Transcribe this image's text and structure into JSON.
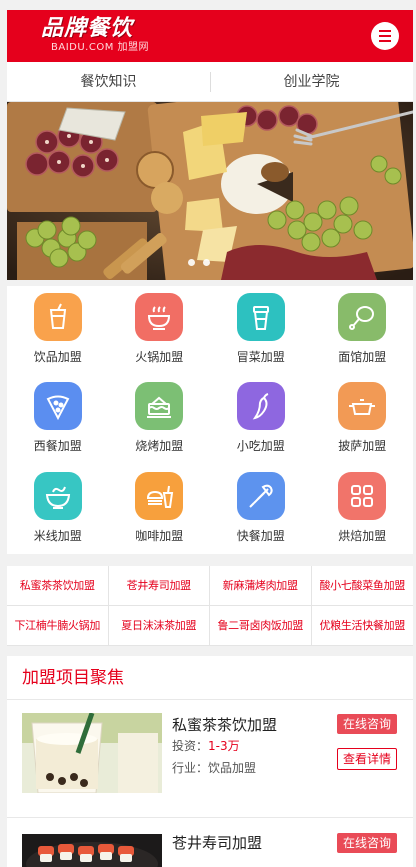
{
  "header": {
    "logo_main": "品牌餐饮",
    "logo_sub": "BAIDU.COM 加盟网",
    "menu_icon": "hamburger-menu-icon"
  },
  "nav": {
    "items": [
      {
        "label": "餐饮知识"
      },
      {
        "label": "创业学院"
      }
    ]
  },
  "banner": {
    "image": "food-platter-photo",
    "slides": 2
  },
  "categories": [
    {
      "label": "饮品加盟",
      "icon": "drink-cup-icon",
      "color": "#f9a24c"
    },
    {
      "label": "火锅加盟",
      "icon": "hotpot-icon",
      "color": "#f16e64"
    },
    {
      "label": "冒菜加盟",
      "icon": "takeaway-cup-icon",
      "color": "#2dc1c0"
    },
    {
      "label": "面馆加盟",
      "icon": "chicken-leg-icon",
      "color": "#88bb6a"
    },
    {
      "label": "西餐加盟",
      "icon": "pizza-icon",
      "color": "#5b8ef0"
    },
    {
      "label": "烧烤加盟",
      "icon": "cake-icon",
      "color": "#7cbf74"
    },
    {
      "label": "小吃加盟",
      "icon": "chili-icon",
      "color": "#8e67e0"
    },
    {
      "label": "披萨加盟",
      "icon": "pot-icon",
      "color": "#f29a55"
    },
    {
      "label": "米线加盟",
      "icon": "noodle-bowl-icon",
      "color": "#37c6c3"
    },
    {
      "label": "咖啡加盟",
      "icon": "burger-drink-icon",
      "color": "#f7a03d"
    },
    {
      "label": "快餐加盟",
      "icon": "ice-cream-icon",
      "color": "#5d93ee"
    },
    {
      "label": "烘焙加盟",
      "icon": "grid-squares-icon",
      "color": "#f1746a"
    }
  ],
  "hot_links": [
    "私蜜茶茶饮加盟",
    "苍井寿司加盟",
    "新麻蒲烤肉加盟",
    "酸小七酸菜鱼加盟",
    "下江楠牛腩火锅加",
    "夏日沫沫茶加盟",
    "鲁二哥卤肉饭加盟",
    "优粮生活快餐加盟"
  ],
  "section": {
    "title": "加盟项目聚焦",
    "items": [
      {
        "name": "私蜜茶茶饮加盟",
        "invest_label": "投资：",
        "invest_value": "1-3万",
        "industry": "行业：饮品加盟",
        "consult_label": "在线咨询",
        "detail_label": "查看详情",
        "image": "milk-tea-photo"
      },
      {
        "name": "苍井寿司加盟",
        "consult_label": "在线咨询",
        "image": "sushi-photo"
      }
    ]
  },
  "colors": {
    "brand_red": "#e5001c",
    "button_red": "#e94b57"
  }
}
